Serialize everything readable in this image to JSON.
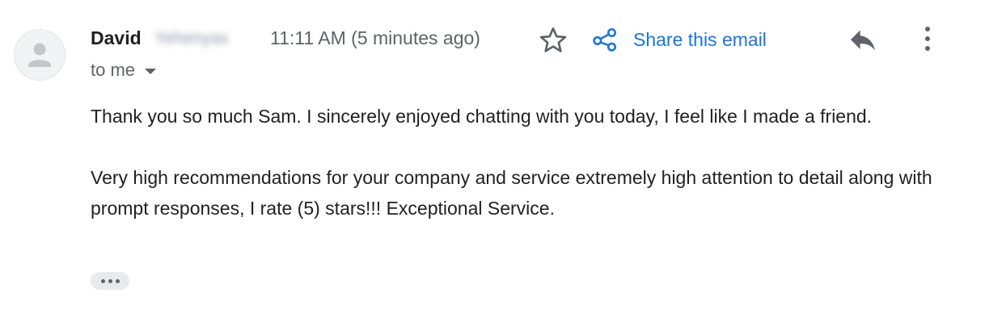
{
  "header": {
    "sender_first_name": "David",
    "sender_surname_obscured": "Yehenyas",
    "timestamp": "11:11 AM (5 minutes ago)",
    "share_label": "Share this email",
    "recipient_label": "to me"
  },
  "icons": {
    "avatar": "default-person-avatar",
    "star": "star-outline-icon",
    "share": "share-network-icon",
    "reply": "reply-arrow-icon",
    "more": "vertical-dots-icon",
    "recipient_dropdown": "caret-down-icon",
    "trimmed_content": "horizontal-dots-icon"
  },
  "colors": {
    "link_blue": "#1a73e8",
    "secondary_text": "#5f6368",
    "primary_text": "#202124"
  },
  "message": {
    "paragraphs": [
      "Thank you so much Sam. I sincerely enjoyed chatting with you today, I feel like I made a friend.",
      "Very high recommendations for your company and service extremely high attention to detail along with prompt responses, I rate (5) stars!!! Exceptional Service."
    ]
  }
}
